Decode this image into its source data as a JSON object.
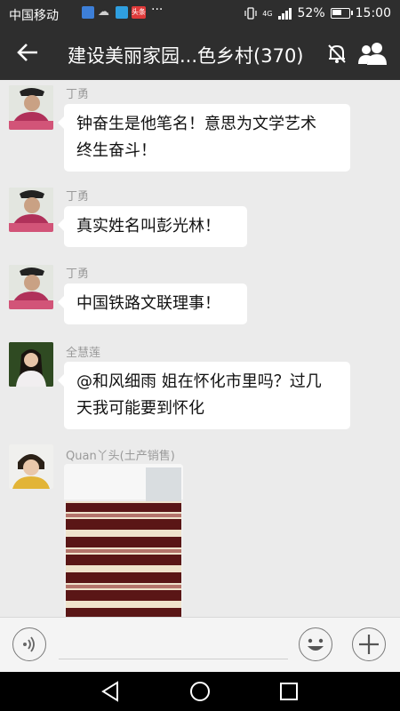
{
  "status_bar": {
    "carrier": "中国移动",
    "more": "···",
    "network": "4G",
    "battery": "52%",
    "time": "15:00",
    "news_badge": "头条"
  },
  "header": {
    "back_icon": "back-arrow-icon",
    "title": "建设美丽家园...色乡村(370)",
    "mute_icon": "muted-bell-icon",
    "members_icon": "group-members-icon"
  },
  "messages": [
    {
      "sender": "丁勇",
      "lines": [
        "钟奋生是他笔名！意思为文学艺术",
        "终生奋斗！"
      ]
    },
    {
      "sender": "丁勇",
      "lines": [
        "真实姓名叫彭光林！"
      ]
    },
    {
      "sender": "丁勇",
      "lines": [
        "中国铁路文联理事！"
      ]
    },
    {
      "sender": "全慧莲",
      "lines": [
        "@和风细雨 姐在怀化市里吗？过几",
        "天我可能要到怀化"
      ]
    },
    {
      "sender": "Quan丫头(土产销售)",
      "image": "product-boxes-photo"
    }
  ],
  "input_bar": {
    "voice_icon": "voice-icon",
    "emoji_icon": "emoji-icon",
    "plus_icon": "plus-icon"
  },
  "colors": {
    "bar": "#2e2e2e",
    "chat_bg": "#ebebeb",
    "bubble": "#ffffff",
    "sender": "#9a9a9a"
  }
}
